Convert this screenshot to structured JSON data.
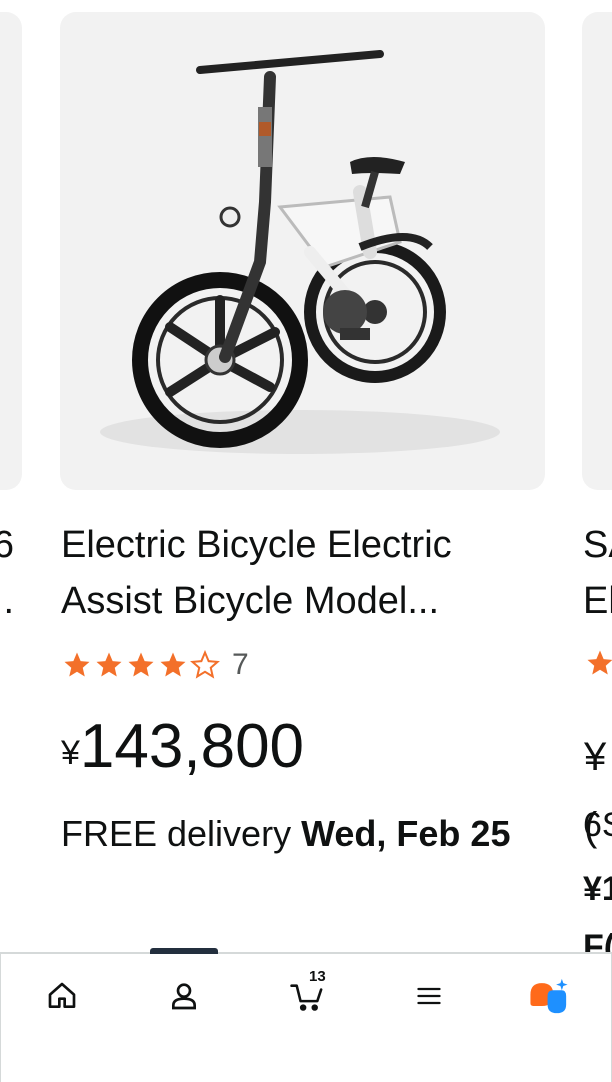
{
  "left_card": {
    "title_fragment": "6\n."
  },
  "main_card": {
    "title": "Electric Bicycle Electric Assist Bicycle Model...",
    "title_line1": "Electric Bicycle Electric",
    "title_line2": "Assist Bicycle Model...",
    "rating": 4,
    "rating_max": 5,
    "rating_count": "7",
    "price_symbol": "¥",
    "price_value": "143,800",
    "delivery_prefix": "FREE delivery ",
    "delivery_date": "Wed, Feb 25",
    "product_image": "white folding electric bicycle"
  },
  "right_card": {
    "title_line1": "SA",
    "title_line2": "El",
    "price_fragment": "¥(",
    "line1": "6S",
    "line2": "¥1",
    "line3": "F("
  },
  "bottom_nav": {
    "items": [
      {
        "name": "home",
        "icon": "home-icon"
      },
      {
        "name": "account",
        "icon": "person-icon"
      },
      {
        "name": "cart",
        "icon": "cart-icon",
        "badge": "13"
      },
      {
        "name": "menu",
        "icon": "hamburger-icon"
      },
      {
        "name": "rufus",
        "icon": "rufus-ai-icon"
      }
    ]
  },
  "colors": {
    "star": "#f3702a",
    "accent_orange": "#ff6a1a",
    "accent_blue": "#1e90ff"
  }
}
